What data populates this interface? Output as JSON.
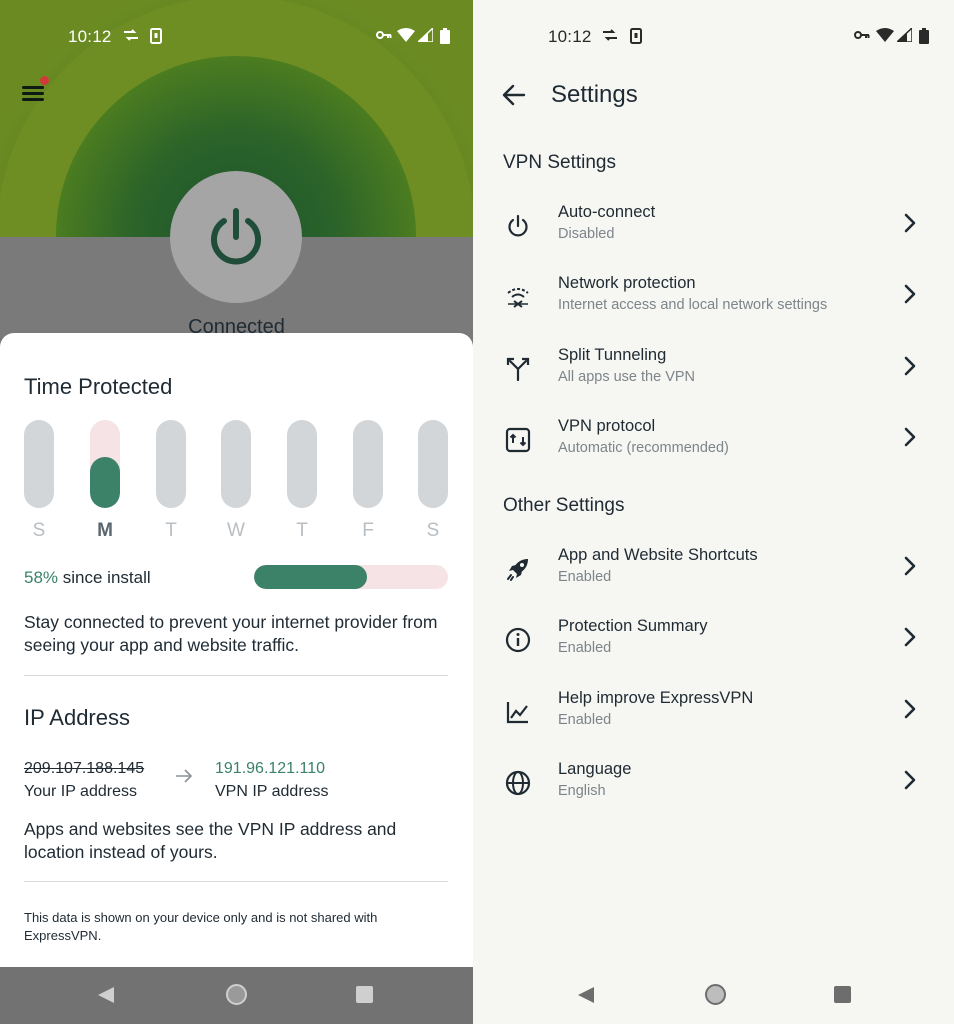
{
  "status_bar": {
    "time": "10:12"
  },
  "left": {
    "connected_label": "Connected",
    "time_protected": {
      "title": "Time Protected",
      "days": [
        {
          "label": "S",
          "fill": 0.0,
          "active": false
        },
        {
          "label": "M",
          "fill": 0.58,
          "active": true
        },
        {
          "label": "T",
          "fill": 0.0,
          "active": false
        },
        {
          "label": "W",
          "fill": 0.0,
          "active": false
        },
        {
          "label": "T",
          "fill": 0.0,
          "active": false
        },
        {
          "label": "F",
          "fill": 0.0,
          "active": false
        },
        {
          "label": "S",
          "fill": 0.0,
          "active": false
        }
      ],
      "percent_value": "58%",
      "percent_suffix": " since install",
      "percent_fraction": 0.58,
      "description": "Stay connected to prevent your internet provider from seeing your app and website traffic."
    },
    "ip_address": {
      "title": "IP Address",
      "old_ip": "209.107.188.145",
      "old_label": "Your IP address",
      "new_ip": "191.96.121.110",
      "new_label": "VPN IP address",
      "description": "Apps and websites see the VPN IP address and location instead of yours."
    },
    "disclaimer": "This data is shown on your device only and is not shared with ExpressVPN."
  },
  "right": {
    "title": "Settings",
    "vpn_section": "VPN Settings",
    "other_section": "Other Settings",
    "vpn_items": [
      {
        "icon": "power-icon",
        "title": "Auto-connect",
        "subtitle": "Disabled"
      },
      {
        "icon": "network-protection-icon",
        "title": "Network protection",
        "subtitle": "Internet access and local network settings"
      },
      {
        "icon": "split-tunnel-icon",
        "title": "Split Tunneling",
        "subtitle": "All apps use the VPN"
      },
      {
        "icon": "protocol-icon",
        "title": "VPN protocol",
        "subtitle": "Automatic (recommended)"
      }
    ],
    "other_items": [
      {
        "icon": "rocket-icon",
        "title": "App and Website Shortcuts",
        "subtitle": "Enabled"
      },
      {
        "icon": "info-icon",
        "title": "Protection Summary",
        "subtitle": "Enabled"
      },
      {
        "icon": "chart-icon",
        "title": "Help improve ExpressVPN",
        "subtitle": "Enabled"
      },
      {
        "icon": "globe-icon",
        "title": "Language",
        "subtitle": "English"
      }
    ]
  },
  "colors": {
    "accent_green": "#3b8268",
    "hero_green": "#6b8a22",
    "notification_dot": "#d23a3a"
  }
}
